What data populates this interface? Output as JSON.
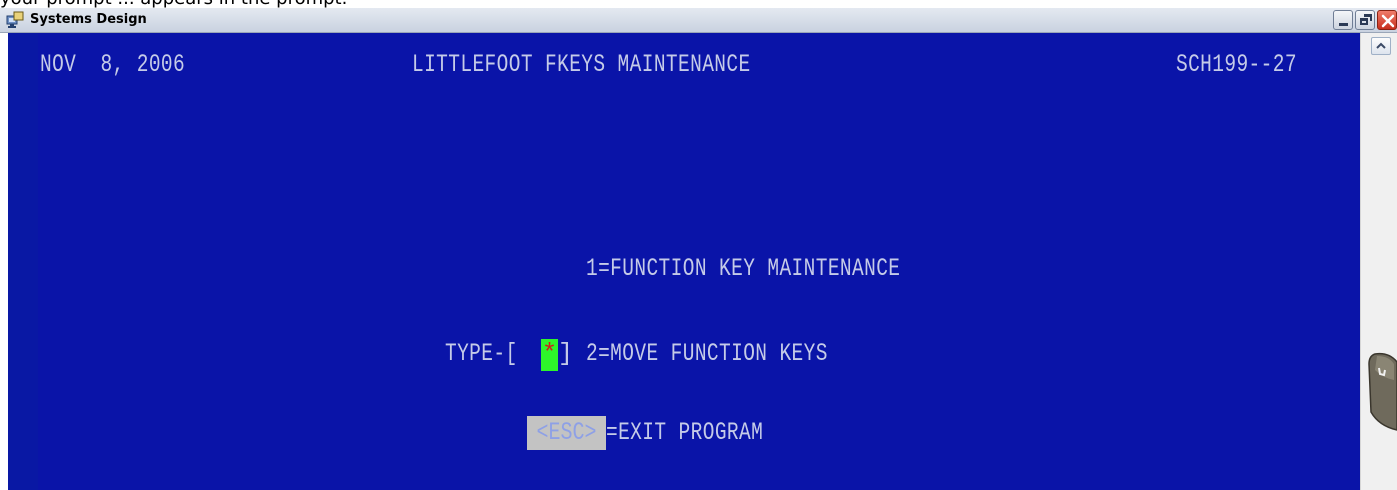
{
  "window": {
    "title": "Systems Design",
    "top_partial": "your prompt ... appears in the prompt."
  },
  "screen": {
    "date": "NOV  8, 2006",
    "heading": "LITTLEFOOT FKEYS MAINTENANCE",
    "screen_code": "SCH199--27",
    "option1": "1=FUNCTION KEY MAINTENANCE",
    "type_prefix": "TYPE-[",
    "type_value": "*",
    "type_suffix": "]",
    "option2": "2=MOVE FUNCTION KEYS",
    "esc_key": "<ESC>",
    "esc_label": "=EXIT PROGRAM"
  },
  "colors": {
    "terminal_bg": "#0a14a8",
    "terminal_text": "#c5cbe8",
    "cursor_bg": "#2ef52a",
    "cursor_text": "#d21a1a",
    "esc_bg": "#c3c3c3"
  }
}
